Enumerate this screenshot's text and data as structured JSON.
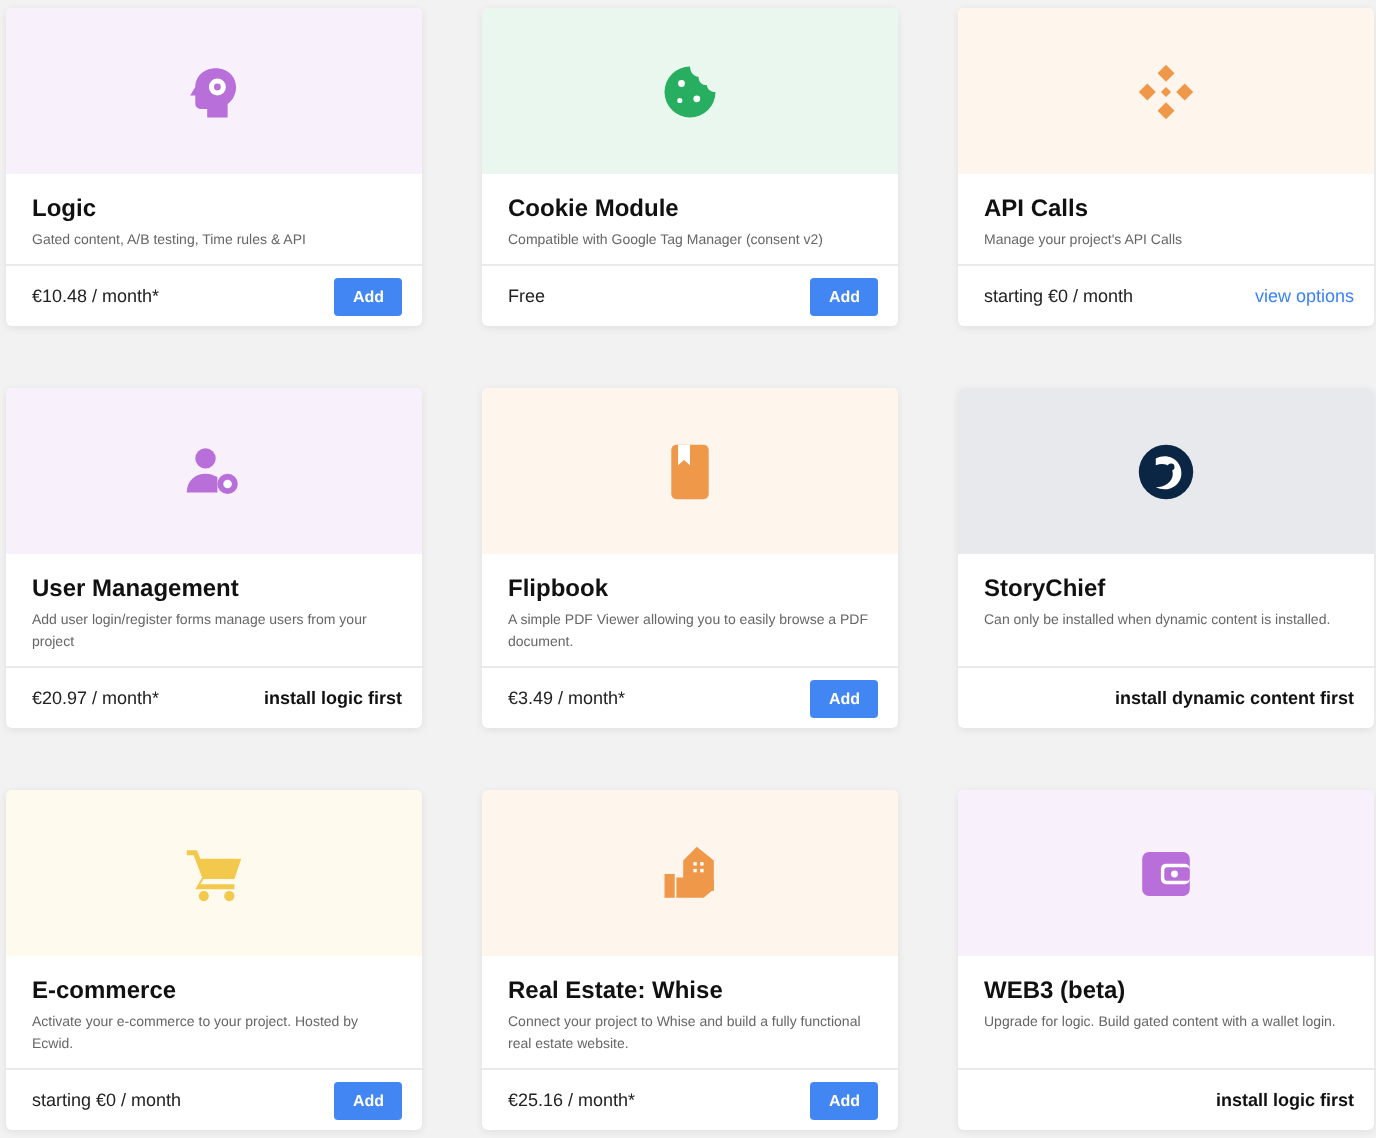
{
  "cards": [
    {
      "title": "Logic",
      "description": "Gated content, A/B testing, Time rules & API",
      "price": "€10.48 / month*",
      "action": {
        "kind": "button",
        "label": "Add"
      },
      "color": "#b86fd9"
    },
    {
      "title": "Cookie Module",
      "description": "Compatible with Google Tag Manager (consent v2)",
      "price": "Free",
      "action": {
        "kind": "button",
        "label": "Add"
      },
      "color": "#27ae60"
    },
    {
      "title": "API Calls",
      "description": "Manage your project's API Calls",
      "price": "starting €0 / month",
      "action": {
        "kind": "link",
        "label": "view options"
      },
      "color": "#f0984a"
    },
    {
      "title": "User Management",
      "description": "Add user login/register forms manage users from your project",
      "price": "€20.97 / month*",
      "action": {
        "kind": "note",
        "label": "install logic first"
      },
      "color": "#b86fd9"
    },
    {
      "title": "Flipbook",
      "description": "A simple PDF Viewer allowing you to easily browse a PDF document.",
      "price": "€3.49 / month*",
      "action": {
        "kind": "button",
        "label": "Add"
      },
      "color": "#f0984a"
    },
    {
      "title": "StoryChief",
      "description": "Can only be installed when dynamic content is installed.",
      "action": {
        "kind": "note",
        "label": "install dynamic content first"
      },
      "color": "#0b2545"
    },
    {
      "title": "E-commerce",
      "description": "Activate your e-commerce to your project. Hosted by Ecwid.",
      "price": "starting €0 / month",
      "action": {
        "kind": "button",
        "label": "Add"
      },
      "color": "#f2c94c"
    },
    {
      "title": "Real Estate: Whise",
      "description": "Connect your project to Whise and build a fully functional real estate website.",
      "price": "€25.16 / month*",
      "action": {
        "kind": "button",
        "label": "Add"
      },
      "color": "#f0984a"
    },
    {
      "title": "WEB3 (beta)",
      "description": "Upgrade for logic. Build gated content with a wallet login.",
      "action": {
        "kind": "note",
        "label": "install logic first"
      },
      "color": "#b86fd9"
    }
  ]
}
